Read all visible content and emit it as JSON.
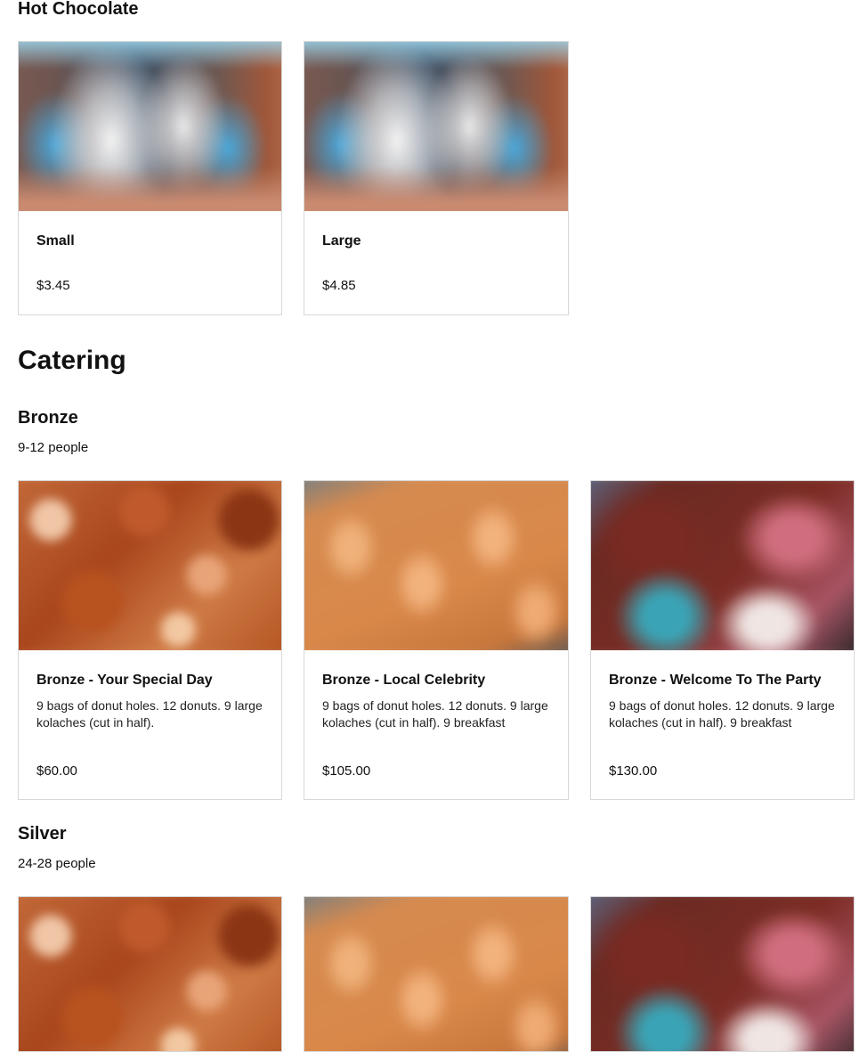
{
  "hot_chocolate": {
    "title": "Hot Chocolate",
    "items": [
      {
        "name": "Small",
        "price": "$3.45",
        "image": "hot-chocolate-photo"
      },
      {
        "name": "Large",
        "price": "$4.85",
        "image": "hot-chocolate-photo"
      }
    ]
  },
  "catering": {
    "title": "Catering",
    "bronze": {
      "title": "Bronze",
      "subtitle": "9-12 people",
      "items": [
        {
          "name": "Bronze - Your Special Day",
          "description": "9 bags of donut holes. 12 donuts. 9 large kolaches (cut in half).",
          "price": "$60.00",
          "image": "donuts-photo"
        },
        {
          "name": "Bronze - Local Celebrity",
          "description": "9 bags of donut holes. 12 donuts. 9 large kolaches (cut in half). 9 breakfast",
          "price": "$105.00",
          "image": "donut-tray-photo"
        },
        {
          "name": "Bronze - Welcome To The Party",
          "description": "9 bags of donut holes. 12 donuts. 9 large kolaches (cut in half). 9 breakfast",
          "price": "$130.00",
          "image": "donut-box-photo"
        }
      ]
    },
    "silver": {
      "title": "Silver",
      "subtitle": "24-28 people"
    }
  }
}
